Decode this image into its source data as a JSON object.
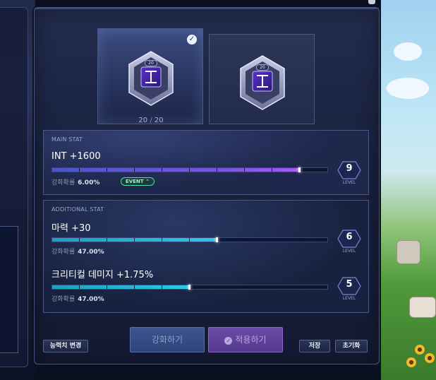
{
  "slots": [
    {
      "tier": "20",
      "selected": true
    },
    {
      "tier": "20",
      "selected": false
    }
  ],
  "slot_count": {
    "current": "20",
    "separator": "/",
    "max": "20"
  },
  "main_stat": {
    "section_label": "MAIN STAT",
    "name": "INT +1600",
    "progress_fraction": 0.9,
    "rate_label": "강화확률",
    "rate_value": "6.00%",
    "event_badge": "EVENT",
    "level": "9",
    "level_label": "LEVEL"
  },
  "additional_stat": {
    "section_label": "ADDITIONAL STAT",
    "stats": [
      {
        "name": "마력 +30",
        "progress_fraction": 0.6,
        "rate_label": "강화확률",
        "rate_value": "47.00%",
        "level": "6",
        "level_label": "LEVEL"
      },
      {
        "name": "크리티컬 데미지 +1.75%",
        "progress_fraction": 0.5,
        "rate_label": "강화확률",
        "rate_value": "47.00%",
        "level": "5",
        "level_label": "LEVEL"
      }
    ]
  },
  "buttons": {
    "enhance": "강화하기",
    "apply": "적용하기",
    "change_ability": "능력치 변경",
    "save": "저장",
    "reset": "초기화"
  },
  "colors": {
    "main_bar": "#7a56e0",
    "additional_bar": "#2ec8e8",
    "event_badge": "#4fe0a0"
  }
}
